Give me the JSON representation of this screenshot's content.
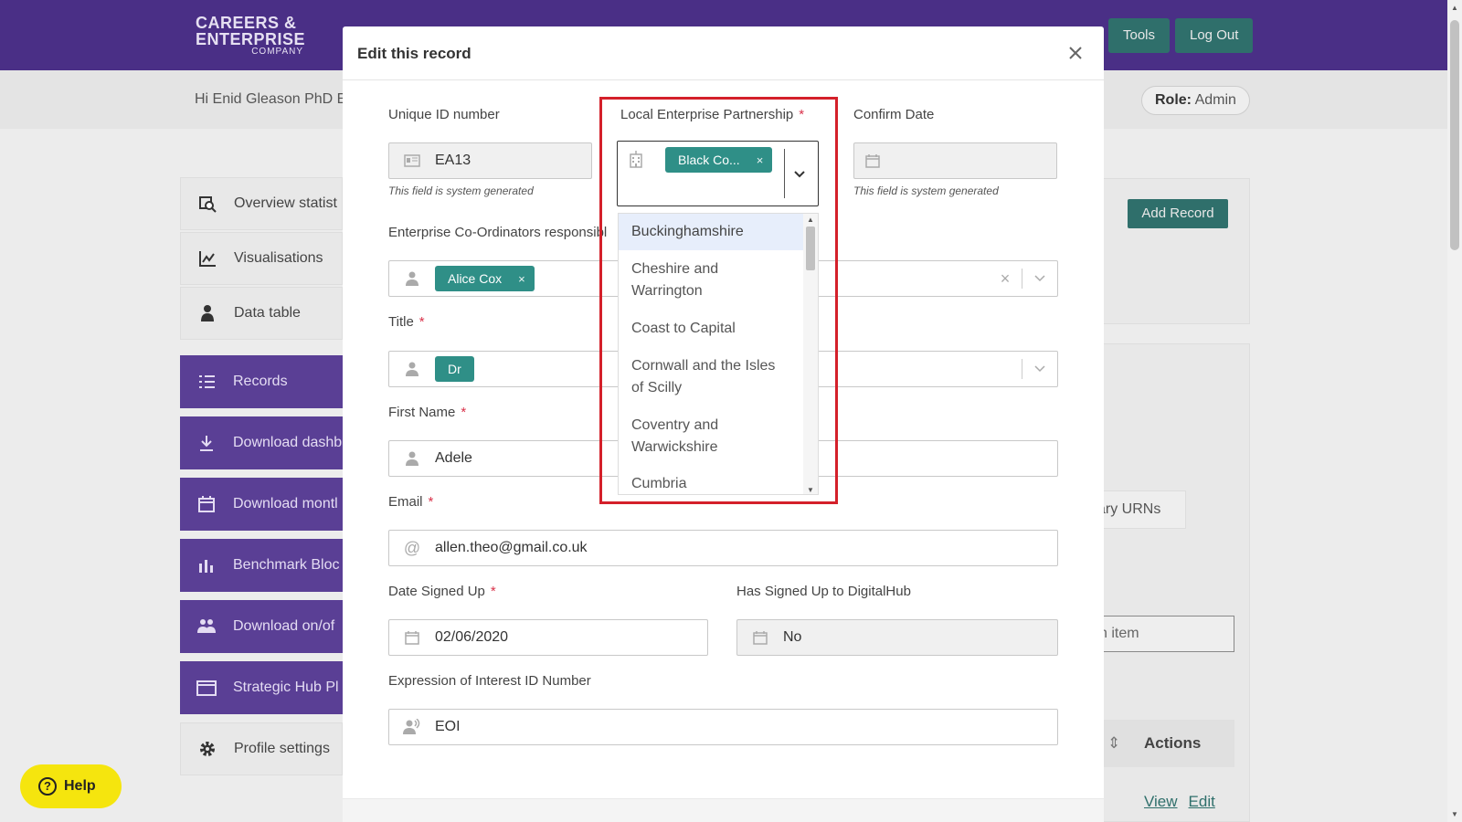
{
  "app": {
    "logo": {
      "line1": "CAREERS &",
      "line2": "ENTERPRISE",
      "line3": "COMPANY"
    },
    "topnav": [
      "Tools",
      "Log Out"
    ],
    "greeting": "Hi Enid Gleason PhD E",
    "role_label": "Role:",
    "role_value": "Admin",
    "sidebar": [
      {
        "label": "Overview statist",
        "icon": "search-chart-icon"
      },
      {
        "label": "Visualisations",
        "icon": "chart-icon"
      },
      {
        "label": "Data table",
        "icon": "user-table-icon"
      },
      {
        "label": "Records",
        "icon": "list-icon"
      },
      {
        "label": "Download dashb",
        "icon": "download-icon"
      },
      {
        "label": "Download montl",
        "icon": "calendar-icon"
      },
      {
        "label": "Benchmark Bloc",
        "icon": "bar-chart-icon"
      },
      {
        "label": "Download on/of",
        "icon": "users-icon"
      },
      {
        "label": "Strategic Hub Pl",
        "icon": "folder-icon"
      },
      {
        "label": "Profile settings",
        "icon": "gear-icon"
      }
    ],
    "add_record": "Add Record",
    "urns": "ary URNs",
    "search_partial": "h item",
    "table_actions": "Actions",
    "row_links": [
      "View",
      "Edit"
    ],
    "help": "Help"
  },
  "modal": {
    "title": "Edit this record",
    "fields": {
      "unique_id": {
        "label": "Unique ID number",
        "value": "EA13",
        "hint": "This field is system generated"
      },
      "lep": {
        "label": "Local Enterprise Partnership",
        "required": "*",
        "chip": "Black Co...",
        "chip_remove": "×"
      },
      "confirm_date": {
        "label": "Confirm Date",
        "value": "",
        "hint": "This field is system generated"
      },
      "coordinators": {
        "label": "Enterprise Co-Ordinators responsibl",
        "chip": "Alice Cox",
        "chip_remove": "×",
        "clear": "×"
      },
      "title": {
        "label": "Title",
        "required": "*",
        "chip": "Dr"
      },
      "first_name": {
        "label": "First Name",
        "required": "*",
        "value": "Adele"
      },
      "email": {
        "label": "Email",
        "required": "*",
        "value": "allen.theo@gmail.co.uk"
      },
      "date_signed": {
        "label": "Date Signed Up",
        "required": "*",
        "value": "02/06/2020"
      },
      "digitalhub": {
        "label": "Has Signed Up to DigitalHub",
        "value": "No"
      },
      "eoi": {
        "label": "Expression of Interest ID Number",
        "value": "EOI"
      }
    },
    "lep_options": [
      {
        "label": "Buckinghamshire",
        "highlighted": true
      },
      {
        "label": "Cheshire and Warrington"
      },
      {
        "label": "Coast to Capital"
      },
      {
        "label": "Cornwall and the Isles of Scilly"
      },
      {
        "label": "Coventry and Warwickshire"
      },
      {
        "label": "Cumbria"
      }
    ]
  },
  "colors": {
    "header": "#4a2f86",
    "teal": "#2f8f87",
    "highlight_box": "#d4202a",
    "help": "#f5e50e"
  }
}
